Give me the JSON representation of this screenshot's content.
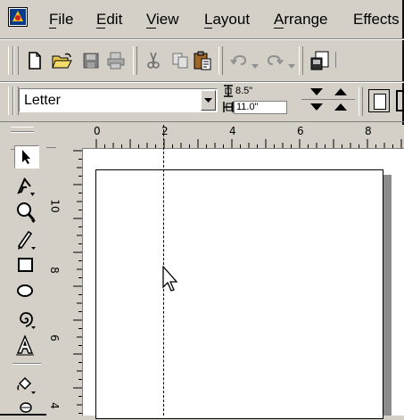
{
  "menu": {
    "items": [
      "File",
      "Edit",
      "View",
      "Layout",
      "Arrange",
      "Effects"
    ]
  },
  "property_bar": {
    "paper_size": "Letter",
    "width_value": "8.5\"",
    "height_value": "11.0\""
  },
  "rulers": {
    "horizontal_labels": [
      "0",
      "2",
      "4",
      "6",
      "8"
    ],
    "vertical_labels": [
      "10",
      "8",
      "6",
      "4"
    ]
  },
  "icons": {
    "app": "coreldraw-app-icon",
    "toolbar": [
      "new-icon",
      "open-icon",
      "save-icon",
      "print-icon",
      "cut-icon",
      "copy-icon",
      "paste-icon",
      "undo-icon",
      "redo-icon",
      "import-icon"
    ],
    "tools": [
      "pick-tool-icon",
      "shape-tool-icon",
      "zoom-tool-icon",
      "freehand-tool-icon",
      "rectangle-tool-icon",
      "ellipse-tool-icon",
      "spiral-tool-icon",
      "text-tool-icon",
      "fill-tool-icon"
    ]
  },
  "colors": {
    "chrome": "#d4d0c8",
    "page_shadow": "#8c8c8c",
    "canvas": "#ffffff"
  }
}
